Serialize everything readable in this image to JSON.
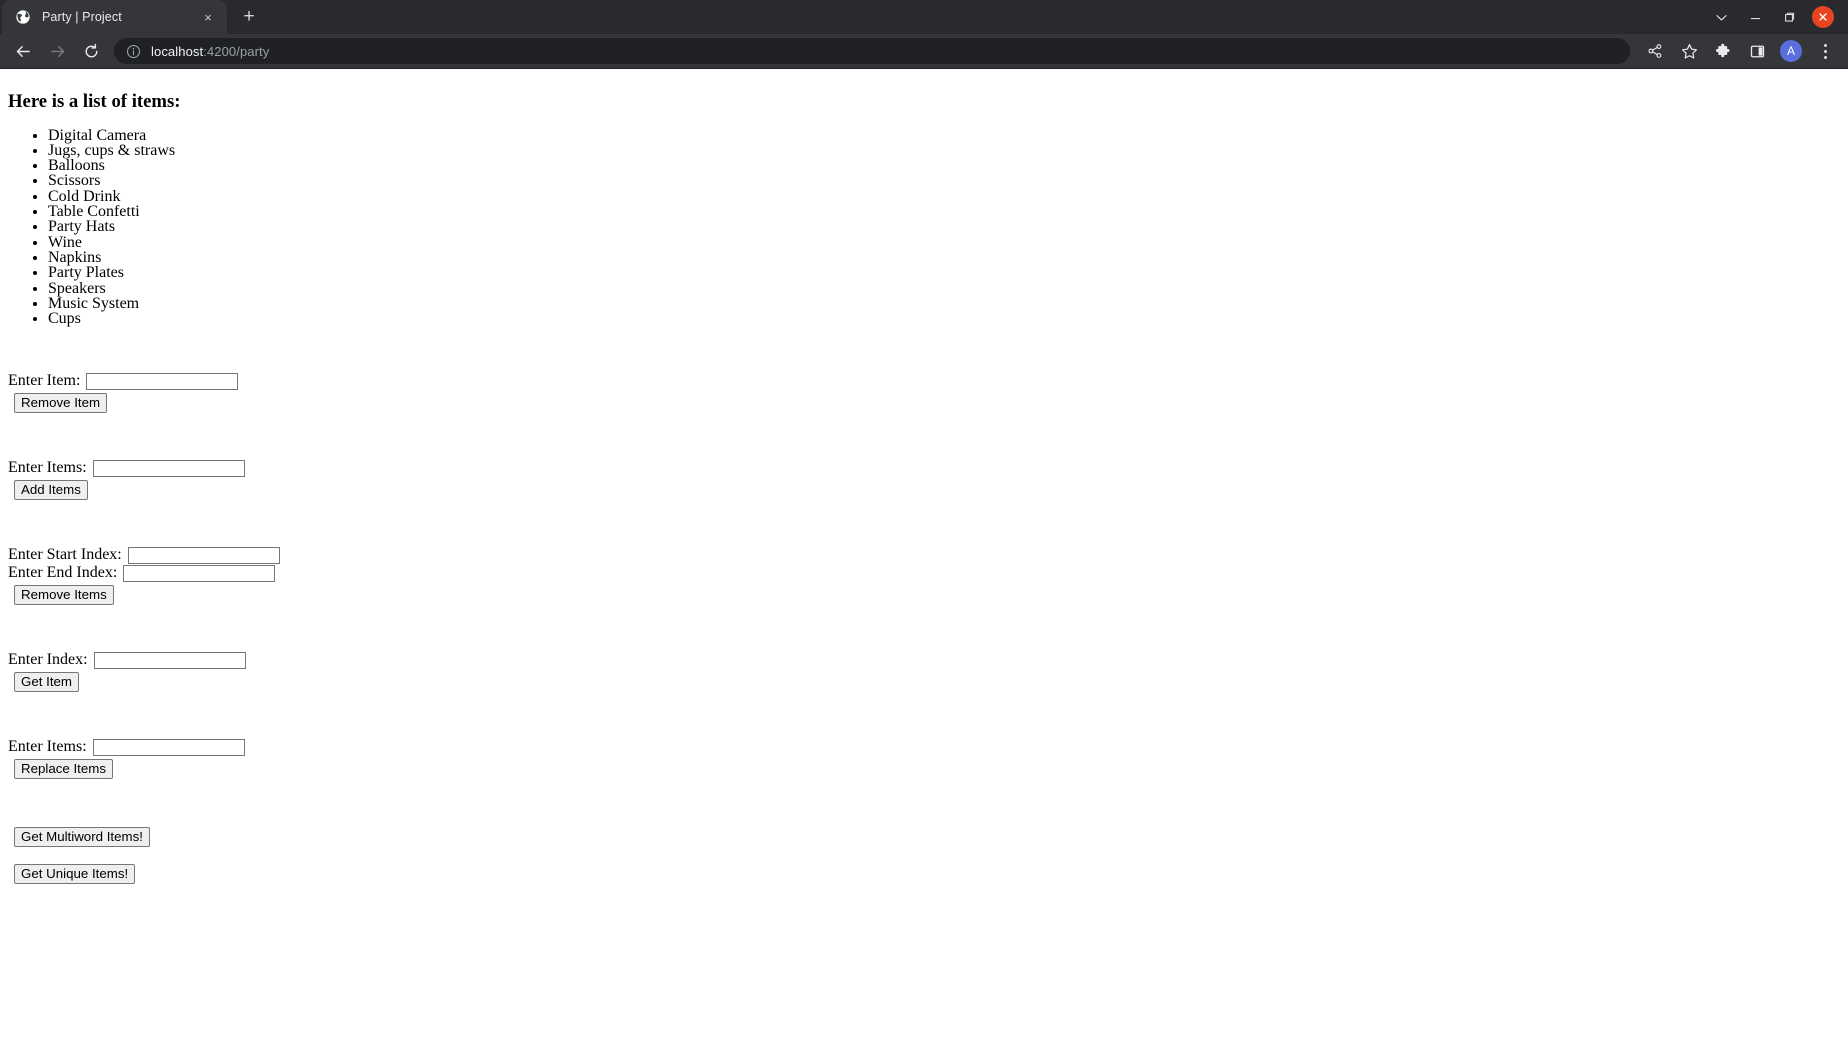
{
  "browser": {
    "tab": {
      "title": "Party | Project",
      "favicon_name": "globe-favicon",
      "close_label": "×"
    },
    "new_tab_label": "+",
    "window_controls": {
      "tab_search_name": "chevron-down-icon",
      "minimize_label": "—",
      "maximize_name": "maximize-icon",
      "close_name": "close-icon"
    },
    "toolbar": {
      "back_name": "back-arrow-icon",
      "forward_name": "forward-arrow-icon",
      "reload_name": "reload-icon",
      "site_info_name": "info-circle-icon",
      "url_host": "localhost",
      "url_path": ":4200/party",
      "url_full": "localhost:4200/party",
      "icons": [
        {
          "name": "share-icon",
          "label": "Share"
        },
        {
          "name": "bookmark-star-icon",
          "label": "Bookmark this tab"
        },
        {
          "name": "extensions-puzzle-icon",
          "label": "Extensions"
        },
        {
          "name": "side-panel-icon",
          "label": "Side panel"
        }
      ],
      "avatar_initial": "A",
      "menu_name": "three-dot-menu-icon"
    },
    "colors": {
      "tabstrip_bg": "#292a2d",
      "toolbar_bg": "#35363a",
      "active_tab_bg": "#35363a",
      "omnibox_bg": "#202124",
      "close_button": "#e8441f",
      "avatar": "#5b6ede",
      "page_bg": "#ffffff"
    }
  },
  "page": {
    "heading": "Here is a list of items:",
    "items": [
      "Digital Camera",
      "Jugs, cups & straws",
      "Balloons",
      "Scissors",
      "Cold Drink",
      "Table Confetti",
      "Party Hats",
      "Wine",
      "Napkins",
      "Party Plates",
      "Speakers",
      "Music System",
      "Cups"
    ],
    "forms": {
      "remove_item": {
        "label": "Enter Item:",
        "value": "",
        "placeholder": "",
        "button": "Remove Item"
      },
      "add_items": {
        "label": "Enter Items:",
        "value": "",
        "placeholder": "",
        "button": "Add Items"
      },
      "remove_range": {
        "start_label": "Enter Start Index:",
        "start_value": "",
        "end_label": "Enter End Index:",
        "end_value": "",
        "button": "Remove Items"
      },
      "get_item": {
        "label": "Enter Index:",
        "value": "",
        "placeholder": "",
        "button": "Get Item"
      },
      "replace_items": {
        "label": "Enter Items:",
        "value": "",
        "placeholder": "",
        "button": "Replace Items"
      },
      "multiword_button": "Get Multiword Items!",
      "unique_button": "Get Unique Items!"
    }
  }
}
